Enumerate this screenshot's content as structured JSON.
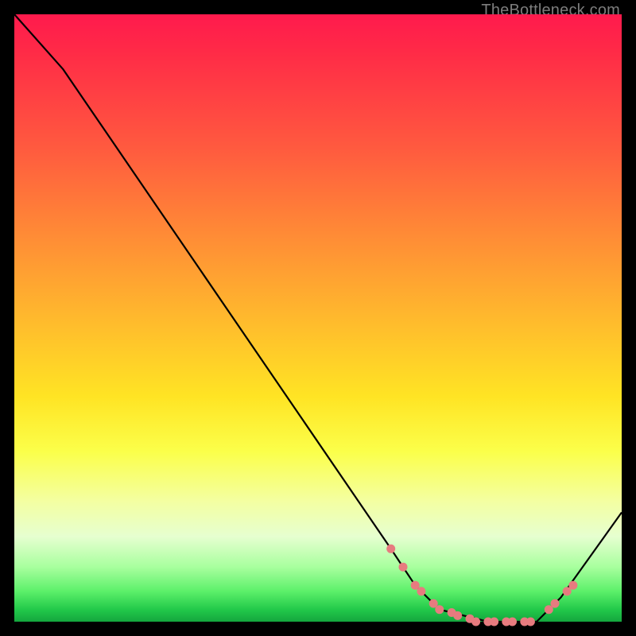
{
  "watermark": "TheBottleneck.com",
  "chart_data": {
    "type": "line",
    "title": "",
    "xlabel": "",
    "ylabel": "",
    "xlim": [
      0,
      100
    ],
    "ylim": [
      0,
      100
    ],
    "series": [
      {
        "name": "curve",
        "x": [
          0,
          8,
          62,
          66,
          70,
          78,
          86,
          90,
          100
        ],
        "y": [
          100,
          91,
          12,
          6,
          2,
          0,
          0,
          4,
          18
        ]
      }
    ],
    "markers": {
      "name": "trough-dots",
      "color": "#e77b7f",
      "x": [
        62,
        64,
        66,
        67,
        69,
        70,
        72,
        73,
        75,
        76,
        78,
        79,
        81,
        82,
        84,
        85,
        88,
        89,
        91,
        92
      ],
      "y": [
        12,
        9,
        6,
        5,
        3,
        2,
        1.5,
        1,
        0.5,
        0,
        0,
        0,
        0,
        0,
        0,
        0,
        2,
        3,
        5,
        6
      ]
    }
  }
}
